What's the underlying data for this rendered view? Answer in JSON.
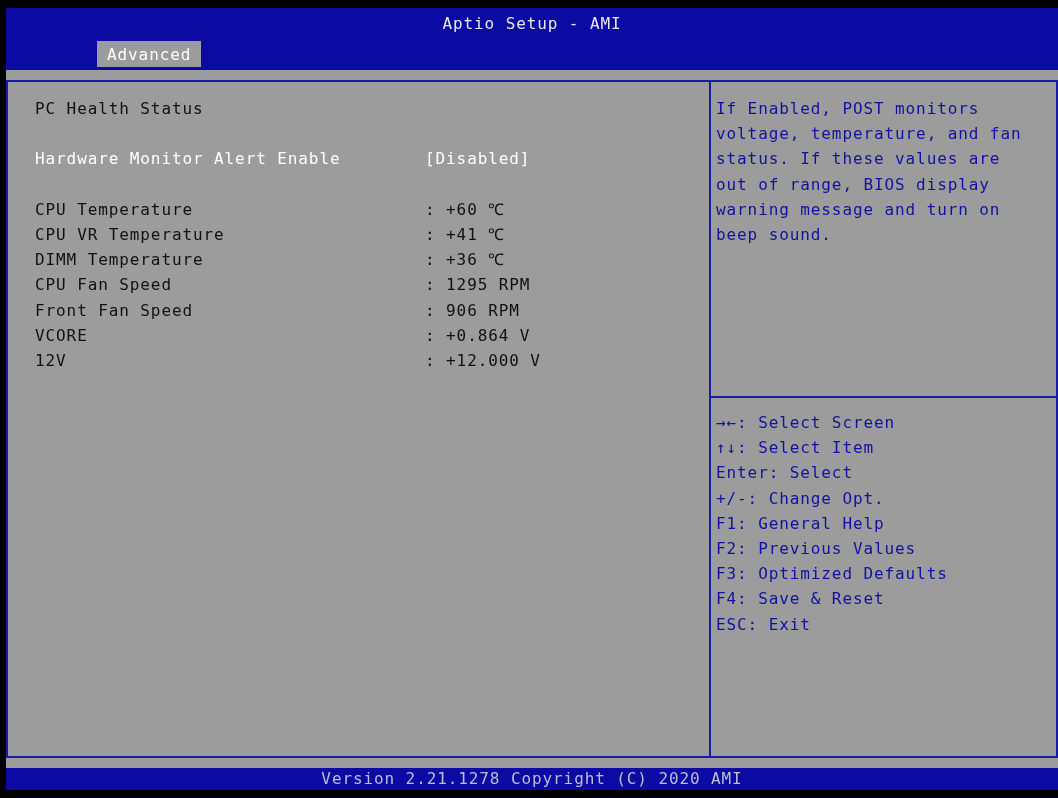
{
  "title": "Aptio Setup - AMI",
  "tabs": [
    {
      "label": "Advanced",
      "selected": true
    }
  ],
  "section_title": "PC Health Status",
  "setting": {
    "label": "Hardware Monitor Alert Enable",
    "value": "[Disabled]",
    "selected": true
  },
  "readings": [
    {
      "label": "CPU Temperature",
      "value": ": +60 ℃"
    },
    {
      "label": "CPU VR Temperature",
      "value": ": +41 ℃"
    },
    {
      "label": "DIMM Temperature",
      "value": ": +36 ℃"
    },
    {
      "label": "CPU Fan Speed",
      "value": ": 1295 RPM"
    },
    {
      "label": "Front Fan Speed",
      "value": ": 906 RPM"
    },
    {
      "label": "VCORE",
      "value": ": +0.864 V"
    },
    {
      "label": "12V",
      "value": ": +12.000 V"
    }
  ],
  "help_text": "If Enabled, POST monitors voltage, temperature, and fan status. If these values are out of range, BIOS display warning message and turn on beep sound.",
  "key_hints": [
    "→←: Select Screen",
    "↑↓: Select Item",
    "Enter: Select",
    "+/-: Change Opt.",
    "F1: General Help",
    "F2: Previous Values",
    "F3: Optimized Defaults",
    "F4: Save & Reset",
    "ESC: Exit"
  ],
  "footer": "Version 2.21.1278 Copyright (C) 2020 AMI"
}
